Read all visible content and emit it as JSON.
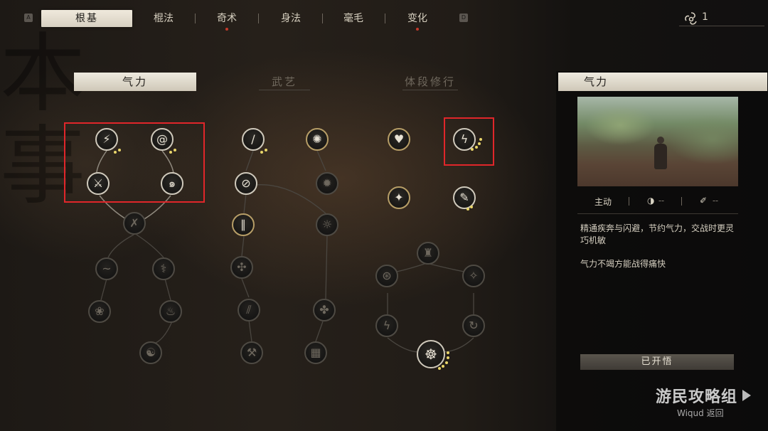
{
  "top_nav": {
    "left_key": "A",
    "right_key": "D",
    "tabs": [
      {
        "label": "根基",
        "active": true,
        "dot": false
      },
      {
        "label": "棍法",
        "active": false,
        "dot": false
      },
      {
        "label": "奇术",
        "active": false,
        "dot": true
      },
      {
        "label": "身法",
        "active": false,
        "dot": false
      },
      {
        "label": "毫毛",
        "active": false,
        "dot": false
      },
      {
        "label": "变化",
        "active": false,
        "dot": true
      }
    ],
    "spirit_points": "1"
  },
  "categories": [
    {
      "label": "气力",
      "active": true
    },
    {
      "label": "武艺",
      "active": false
    },
    {
      "label": "体段修行",
      "active": false
    }
  ],
  "background_calligraphy": "本事",
  "detail_panel": {
    "title": "气力",
    "type_label": "主动",
    "cooldown_value": "--",
    "cost_value": "--",
    "description_1": "精通疾奔与闪避，节约气力，交战时更灵巧机敏",
    "description_2": "气力不竭方能战得痛快",
    "status_button": "已开悟"
  },
  "watermark": {
    "main": "游民攻略组",
    "sub": "Wiqud 返回"
  },
  "colors": {
    "highlight_red": "#e0262a",
    "pip_gold": "#e8d56a",
    "tab_dot_red": "#c43a2b"
  }
}
